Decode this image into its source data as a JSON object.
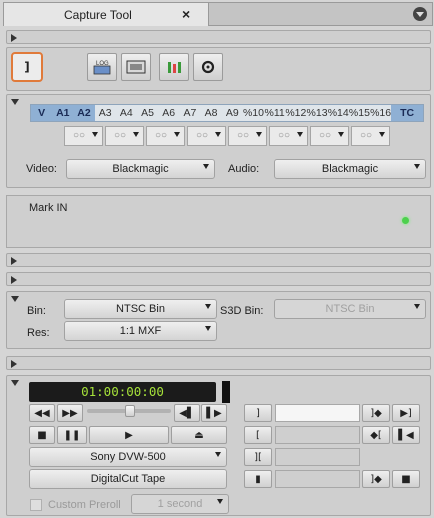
{
  "window": {
    "tab_title": "Capture Tool",
    "close_glyph": "×"
  },
  "toolbar": {
    "toggle_label": "]",
    "log_label": "LOG",
    "icons": [
      "bracket-toggle-icon",
      "log-mode-icon",
      "capture-mode-icon",
      "audio-meters-icon",
      "settings-icon"
    ]
  },
  "tracks": [
    "V",
    "A1",
    "A2",
    "A3",
    "A4",
    "A5",
    "A6",
    "A7",
    "A8",
    "A9",
    "A10",
    "A11",
    "A12",
    "A13",
    "A14",
    "A15",
    "A16",
    "TC"
  ],
  "tracks_display": [
    "V",
    "A1",
    "A2",
    "A3",
    "A4",
    "A5",
    "A6",
    "A7",
    "A8",
    "A9",
    "A10",
    "A11",
    "A12",
    "A13",
    "A14",
    "A15",
    "A16",
    "TC"
  ],
  "track_labels_shown": [
    "V",
    "A1",
    "A2",
    "A3",
    "A4",
    "A5",
    "A6",
    "A7",
    "A8",
    "A9",
    "%10",
    "%11",
    "%12",
    "%13",
    "%14",
    "%15",
    "%16",
    "TC"
  ],
  "active_tracks": [
    "V",
    "A1",
    "A2",
    "TC"
  ],
  "combo_value": "○○",
  "source": {
    "video_label": "Video:",
    "video_value": "Blackmagic",
    "audio_label": "Audio:",
    "audio_value": "Blackmagic"
  },
  "mark_in": {
    "label": "Mark IN"
  },
  "bin": {
    "bin_label": "Bin:",
    "bin_value": "NTSC Bin",
    "s3d_label": "S3D Bin:",
    "s3d_value": "NTSC Bin",
    "res_label": "Res:",
    "res_value": "1:1  MXF"
  },
  "deck": {
    "timecode": "01:00:00:00",
    "deck_name": "Sony DVW-500",
    "tape_name": "DigitalCut Tape",
    "preroll_label": "Custom Preroll",
    "preroll_value": "1 second",
    "transport": [
      "◀◀",
      "▶▶",
      "◀▌",
      "▌▶",
      "■",
      "❚❚",
      "▶",
      "⏏"
    ],
    "mark_buttons": [
      "]",
      "[",
      "][",
      "▮"
    ],
    "go_buttons": [
      "]◆",
      "◆[",
      "▶]",
      "▌◀"
    ]
  }
}
